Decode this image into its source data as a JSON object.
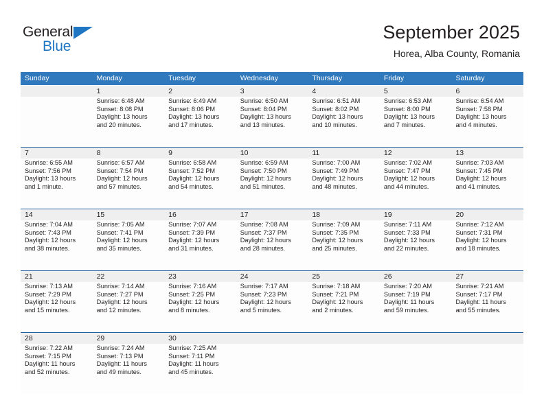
{
  "brand": {
    "name_part1": "General",
    "name_part2": "Blue",
    "triangle_color": "#1f76c2",
    "text_color": "#231f20"
  },
  "header": {
    "title": "September 2025",
    "subtitle": "Horea, Alba County, Romania"
  },
  "theme": {
    "header_blue": "#3079bd",
    "rule_blue": "#1f5fa0",
    "daynum_band": "#efefef",
    "text": "#231f20"
  },
  "weekdays": [
    "Sunday",
    "Monday",
    "Tuesday",
    "Wednesday",
    "Thursday",
    "Friday",
    "Saturday"
  ],
  "weeks": [
    [
      {
        "day": "",
        "sunrise": "",
        "sunset": "",
        "daylight_line1": "",
        "daylight_line2": ""
      },
      {
        "day": "1",
        "sunrise": "Sunrise: 6:48 AM",
        "sunset": "Sunset: 8:08 PM",
        "daylight_line1": "Daylight: 13 hours",
        "daylight_line2": "and 20 minutes."
      },
      {
        "day": "2",
        "sunrise": "Sunrise: 6:49 AM",
        "sunset": "Sunset: 8:06 PM",
        "daylight_line1": "Daylight: 13 hours",
        "daylight_line2": "and 17 minutes."
      },
      {
        "day": "3",
        "sunrise": "Sunrise: 6:50 AM",
        "sunset": "Sunset: 8:04 PM",
        "daylight_line1": "Daylight: 13 hours",
        "daylight_line2": "and 13 minutes."
      },
      {
        "day": "4",
        "sunrise": "Sunrise: 6:51 AM",
        "sunset": "Sunset: 8:02 PM",
        "daylight_line1": "Daylight: 13 hours",
        "daylight_line2": "and 10 minutes."
      },
      {
        "day": "5",
        "sunrise": "Sunrise: 6:53 AM",
        "sunset": "Sunset: 8:00 PM",
        "daylight_line1": "Daylight: 13 hours",
        "daylight_line2": "and 7 minutes."
      },
      {
        "day": "6",
        "sunrise": "Sunrise: 6:54 AM",
        "sunset": "Sunset: 7:58 PM",
        "daylight_line1": "Daylight: 13 hours",
        "daylight_line2": "and 4 minutes."
      }
    ],
    [
      {
        "day": "7",
        "sunrise": "Sunrise: 6:55 AM",
        "sunset": "Sunset: 7:56 PM",
        "daylight_line1": "Daylight: 13 hours",
        "daylight_line2": "and 1 minute."
      },
      {
        "day": "8",
        "sunrise": "Sunrise: 6:57 AM",
        "sunset": "Sunset: 7:54 PM",
        "daylight_line1": "Daylight: 12 hours",
        "daylight_line2": "and 57 minutes."
      },
      {
        "day": "9",
        "sunrise": "Sunrise: 6:58 AM",
        "sunset": "Sunset: 7:52 PM",
        "daylight_line1": "Daylight: 12 hours",
        "daylight_line2": "and 54 minutes."
      },
      {
        "day": "10",
        "sunrise": "Sunrise: 6:59 AM",
        "sunset": "Sunset: 7:50 PM",
        "daylight_line1": "Daylight: 12 hours",
        "daylight_line2": "and 51 minutes."
      },
      {
        "day": "11",
        "sunrise": "Sunrise: 7:00 AM",
        "sunset": "Sunset: 7:49 PM",
        "daylight_line1": "Daylight: 12 hours",
        "daylight_line2": "and 48 minutes."
      },
      {
        "day": "12",
        "sunrise": "Sunrise: 7:02 AM",
        "sunset": "Sunset: 7:47 PM",
        "daylight_line1": "Daylight: 12 hours",
        "daylight_line2": "and 44 minutes."
      },
      {
        "day": "13",
        "sunrise": "Sunrise: 7:03 AM",
        "sunset": "Sunset: 7:45 PM",
        "daylight_line1": "Daylight: 12 hours",
        "daylight_line2": "and 41 minutes."
      }
    ],
    [
      {
        "day": "14",
        "sunrise": "Sunrise: 7:04 AM",
        "sunset": "Sunset: 7:43 PM",
        "daylight_line1": "Daylight: 12 hours",
        "daylight_line2": "and 38 minutes."
      },
      {
        "day": "15",
        "sunrise": "Sunrise: 7:05 AM",
        "sunset": "Sunset: 7:41 PM",
        "daylight_line1": "Daylight: 12 hours",
        "daylight_line2": "and 35 minutes."
      },
      {
        "day": "16",
        "sunrise": "Sunrise: 7:07 AM",
        "sunset": "Sunset: 7:39 PM",
        "daylight_line1": "Daylight: 12 hours",
        "daylight_line2": "and 31 minutes."
      },
      {
        "day": "17",
        "sunrise": "Sunrise: 7:08 AM",
        "sunset": "Sunset: 7:37 PM",
        "daylight_line1": "Daylight: 12 hours",
        "daylight_line2": "and 28 minutes."
      },
      {
        "day": "18",
        "sunrise": "Sunrise: 7:09 AM",
        "sunset": "Sunset: 7:35 PM",
        "daylight_line1": "Daylight: 12 hours",
        "daylight_line2": "and 25 minutes."
      },
      {
        "day": "19",
        "sunrise": "Sunrise: 7:11 AM",
        "sunset": "Sunset: 7:33 PM",
        "daylight_line1": "Daylight: 12 hours",
        "daylight_line2": "and 22 minutes."
      },
      {
        "day": "20",
        "sunrise": "Sunrise: 7:12 AM",
        "sunset": "Sunset: 7:31 PM",
        "daylight_line1": "Daylight: 12 hours",
        "daylight_line2": "and 18 minutes."
      }
    ],
    [
      {
        "day": "21",
        "sunrise": "Sunrise: 7:13 AM",
        "sunset": "Sunset: 7:29 PM",
        "daylight_line1": "Daylight: 12 hours",
        "daylight_line2": "and 15 minutes."
      },
      {
        "day": "22",
        "sunrise": "Sunrise: 7:14 AM",
        "sunset": "Sunset: 7:27 PM",
        "daylight_line1": "Daylight: 12 hours",
        "daylight_line2": "and 12 minutes."
      },
      {
        "day": "23",
        "sunrise": "Sunrise: 7:16 AM",
        "sunset": "Sunset: 7:25 PM",
        "daylight_line1": "Daylight: 12 hours",
        "daylight_line2": "and 8 minutes."
      },
      {
        "day": "24",
        "sunrise": "Sunrise: 7:17 AM",
        "sunset": "Sunset: 7:23 PM",
        "daylight_line1": "Daylight: 12 hours",
        "daylight_line2": "and 5 minutes."
      },
      {
        "day": "25",
        "sunrise": "Sunrise: 7:18 AM",
        "sunset": "Sunset: 7:21 PM",
        "daylight_line1": "Daylight: 12 hours",
        "daylight_line2": "and 2 minutes."
      },
      {
        "day": "26",
        "sunrise": "Sunrise: 7:20 AM",
        "sunset": "Sunset: 7:19 PM",
        "daylight_line1": "Daylight: 11 hours",
        "daylight_line2": "and 59 minutes."
      },
      {
        "day": "27",
        "sunrise": "Sunrise: 7:21 AM",
        "sunset": "Sunset: 7:17 PM",
        "daylight_line1": "Daylight: 11 hours",
        "daylight_line2": "and 55 minutes."
      }
    ],
    [
      {
        "day": "28",
        "sunrise": "Sunrise: 7:22 AM",
        "sunset": "Sunset: 7:15 PM",
        "daylight_line1": "Daylight: 11 hours",
        "daylight_line2": "and 52 minutes."
      },
      {
        "day": "29",
        "sunrise": "Sunrise: 7:24 AM",
        "sunset": "Sunset: 7:13 PM",
        "daylight_line1": "Daylight: 11 hours",
        "daylight_line2": "and 49 minutes."
      },
      {
        "day": "30",
        "sunrise": "Sunrise: 7:25 AM",
        "sunset": "Sunset: 7:11 PM",
        "daylight_line1": "Daylight: 11 hours",
        "daylight_line2": "and 45 minutes."
      },
      {
        "day": "",
        "sunrise": "",
        "sunset": "",
        "daylight_line1": "",
        "daylight_line2": ""
      },
      {
        "day": "",
        "sunrise": "",
        "sunset": "",
        "daylight_line1": "",
        "daylight_line2": ""
      },
      {
        "day": "",
        "sunrise": "",
        "sunset": "",
        "daylight_line1": "",
        "daylight_line2": ""
      },
      {
        "day": "",
        "sunrise": "",
        "sunset": "",
        "daylight_line1": "",
        "daylight_line2": ""
      }
    ]
  ]
}
